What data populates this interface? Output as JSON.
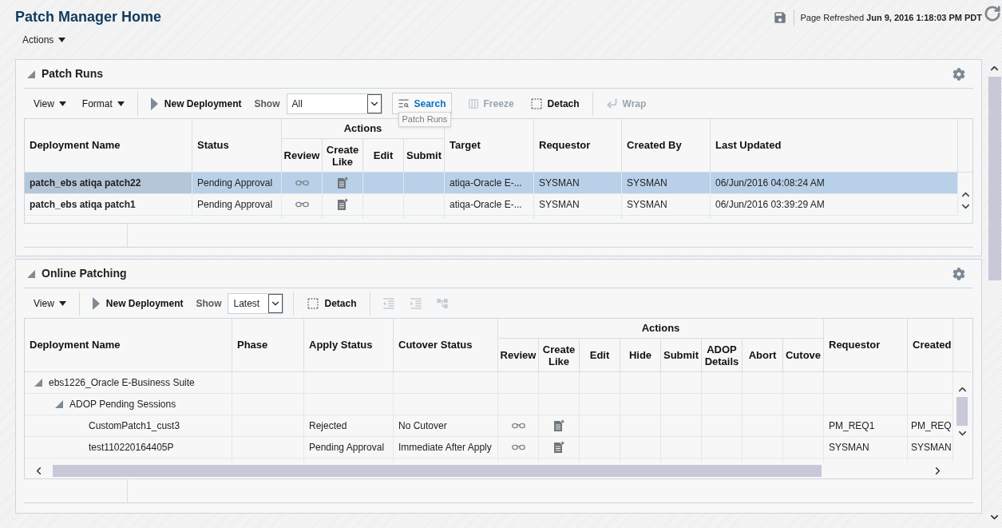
{
  "page": {
    "title": "Patch Manager Home",
    "actions_menu": "Actions",
    "refresh_label": "Page Refreshed",
    "refresh_time": "Jun 9, 2016 1:18:03 PM PDT"
  },
  "patch_runs": {
    "title": "Patch Runs",
    "expanded": true,
    "toolbar": [
      [
        {
          "kind": "menu",
          "label": "View",
          "disabled": false
        },
        {
          "kind": "menu",
          "label": "Format",
          "disabled": false
        }
      ],
      [
        {
          "kind": "new",
          "label": "New Deployment",
          "disabled": false
        },
        {
          "kind": "show",
          "label": "Show",
          "value": "All",
          "disabled": false
        },
        {
          "kind": "search",
          "label": "Search",
          "tooltip": "Patch Runs",
          "disabled": false
        },
        {
          "kind": "freeze",
          "label": "Freeze",
          "disabled": true
        },
        {
          "kind": "detach",
          "label": "Detach",
          "disabled": false
        }
      ],
      [
        {
          "kind": "wrap",
          "label": "Wrap",
          "disabled": true
        }
      ]
    ],
    "columns_before": [
      "Deployment Name",
      "Status"
    ],
    "actions": {
      "label": "Actions",
      "columns": [
        "Review",
        "Create Like",
        "Edit",
        "Submit"
      ]
    },
    "columns_after": [
      "Target",
      "Requestor",
      "Created By",
      "Last Updated"
    ],
    "rows": [
      {
        "deployment_name": "patch_ebs atiqa patch22",
        "status": "Pending Approval",
        "review": true,
        "create_like": true,
        "target": "atiqa-Oracle E-...",
        "requestor": "SYSMAN",
        "created_by": "SYSMAN",
        "last_updated": "06/Jun/2016 04:08:24 AM",
        "selected": true
      },
      {
        "deployment_name": "patch_ebs atiqa patch1",
        "status": "Pending Approval",
        "review": true,
        "create_like": true,
        "target": "atiqa-Oracle E-...",
        "requestor": "SYSMAN",
        "created_by": "SYSMAN",
        "last_updated": "06/Jun/2016 03:39:29 AM",
        "selected": false
      }
    ]
  },
  "online_patching": {
    "title": "Online Patching",
    "expanded": true,
    "toolbar": [
      [
        {
          "kind": "menu",
          "label": "View",
          "disabled": false
        }
      ],
      [
        {
          "kind": "new",
          "label": "New Deployment",
          "disabled": false
        },
        {
          "kind": "show",
          "label": "Show",
          "value": "Latest",
          "disabled": false
        }
      ],
      [
        {
          "kind": "detach",
          "label": "Detach",
          "disabled": false
        }
      ],
      [
        {
          "kind": "outdent",
          "disabled": true
        },
        {
          "kind": "indent",
          "disabled": true
        },
        {
          "kind": "tree",
          "disabled": true
        }
      ]
    ],
    "columns_before": [
      "Deployment Name",
      "Phase",
      "Apply Status",
      "Cutover Status"
    ],
    "actions": {
      "label": "Actions",
      "columns": [
        "Review",
        "Create Like",
        "Edit",
        "Hide",
        "Submit",
        "ADOP Details",
        "Abort",
        "Cutove"
      ]
    },
    "columns_after": [
      "Requestor",
      "Created"
    ],
    "rows": [
      {
        "name": "ebs1226_Oracle E-Business Suite",
        "expanded": true,
        "children": [
          {
            "name": "ADOP Pending Sessions",
            "expanded": true,
            "children": [
              {
                "name": "CustomPatch1_cust3",
                "apply_status": "Rejected",
                "cutover_status": "No Cutover",
                "review": true,
                "create_like": true,
                "requestor": "PM_REQ1",
                "created": "PM_REQ"
              },
              {
                "name": "test110220164405P",
                "apply_status": "Pending Approval",
                "cutover_status": "Immediate After Apply",
                "review": true,
                "create_like": true,
                "requestor": "SYSMAN",
                "created": "SYSMAN"
              }
            ]
          }
        ]
      }
    ]
  }
}
